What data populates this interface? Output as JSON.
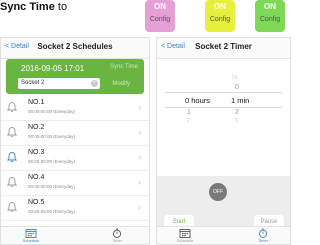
{
  "header": {
    "text_bold": "Sync Time",
    "text_suffix": "to",
    "buttons": [
      {
        "on": "ON",
        "label": "Config",
        "color": "#e6a0d8"
      },
      {
        "on": "ON",
        "label": "Config",
        "color": "#e6f03a"
      },
      {
        "on": "ON",
        "label": "Config",
        "color": "#7ed957"
      }
    ]
  },
  "schedules_screen": {
    "back": "< Detail",
    "title": "Socket 2 Schedules",
    "datetime": "2016-09-05 17:01",
    "sync_time": "Sync Time",
    "socket_input_value": "Socket 2",
    "clear_icon": "clear-icon",
    "modify": "Modify",
    "schedules": [
      {
        "name": "NO.1",
        "time": "00:00-00:00 (Everyday)",
        "bell_color": "#9a9a9a"
      },
      {
        "name": "NO.2",
        "time": "00:00-00:00 (Everyday)",
        "bell_color": "#9a9a9a"
      },
      {
        "name": "NO.3",
        "time": "06:00-00:00 (Everyday)",
        "bell_color": "#3b82c4"
      },
      {
        "name": "NO.4",
        "time": "00:00-00:00 (Everyday)",
        "bell_color": "#9a9a9a"
      },
      {
        "name": "NO.5",
        "time": "00:00-00:00 (Everyday)",
        "bell_color": "#9a9a9a"
      }
    ],
    "tabs": [
      {
        "label": "Schedule",
        "icon": "calendar-icon",
        "active": true
      },
      {
        "label": "Timer",
        "icon": "stopwatch-icon",
        "active": false
      }
    ]
  },
  "timer_screen": {
    "back": "< Detail",
    "title": "Socket 2 Timer",
    "picker": {
      "above2": "59",
      "above1_min": "0",
      "selected_hours": "0 hours",
      "selected_min": "1 min",
      "below1_hour": "1",
      "below1_min": "2",
      "below2_hour": "2",
      "below2_min": "3"
    },
    "off_label": "OFF",
    "start_label": "Start",
    "pause_label": "Pause",
    "tabs": [
      {
        "label": "Schedule",
        "icon": "calendar-icon",
        "active": false
      },
      {
        "label": "Timer",
        "icon": "stopwatch-icon",
        "active": true
      }
    ]
  },
  "colors": {
    "accent_blue": "#3b82c4",
    "green": "#6ab541",
    "panel_gray": "#ededed"
  }
}
